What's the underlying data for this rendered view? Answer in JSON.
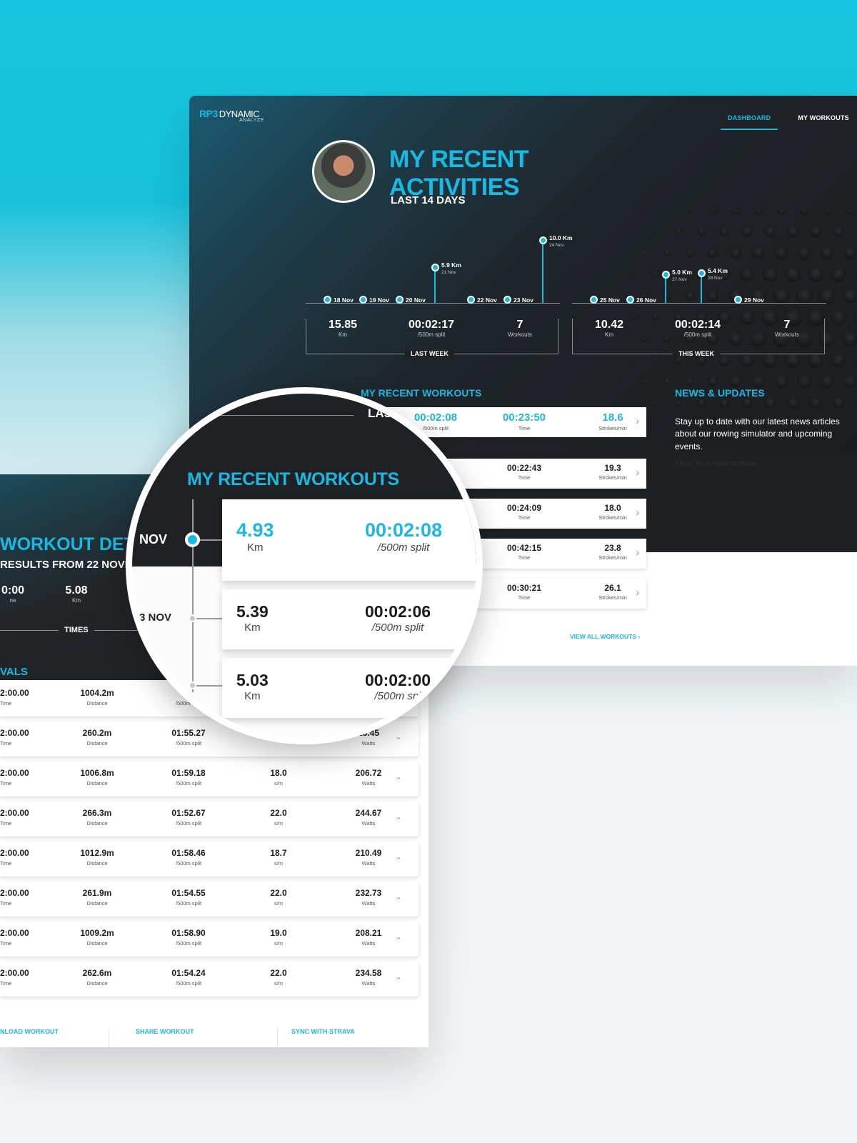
{
  "dashboard": {
    "logo": {
      "brand_prefix": "RP3",
      "brand_word": "DYNAMIC",
      "sub": "ANALYZE"
    },
    "nav": [
      "DASHBOARD",
      "MY WORKOUTS"
    ],
    "title_line1": "MY RECENT",
    "title_line2": "ACTIVITIES",
    "subtitle": "LAST 14 DAYS",
    "timeline": [
      {
        "date": "18 Nov"
      },
      {
        "date": "19 Nov"
      },
      {
        "date": "20 Nov"
      },
      {
        "value": "5.9 Km",
        "date": "21 Nov"
      },
      {
        "date": "22 Nov"
      },
      {
        "date": "23 Nov"
      },
      {
        "value": "10.0 Km",
        "date": "24 Nov"
      },
      {
        "date": "25 Nov"
      },
      {
        "date": "26 Nov"
      },
      {
        "value": "5.0 Km",
        "date": "27 Nov"
      },
      {
        "value": "5.4 Km",
        "date": "28 Nov"
      },
      {
        "date": "29 Nov"
      }
    ],
    "last_week": {
      "label": "LAST WEEK",
      "stats": [
        {
          "value": "15.85",
          "unit": "Km"
        },
        {
          "value": "00:02:17",
          "unit": "/500m split"
        },
        {
          "value": "7",
          "unit": "Workouts"
        }
      ]
    },
    "this_week": {
      "label": "THIS WEEK",
      "stats": [
        {
          "value": "10.42",
          "unit": "Km"
        },
        {
          "value": "00:02:14",
          "unit": "/500m split"
        },
        {
          "value": "7",
          "unit": "Workouts"
        }
      ]
    },
    "workouts_title": "MY RECENT WORKOUTS",
    "workouts": [
      {
        "split": "00:02:08",
        "split_unit": "/500m split",
        "time": "00:23:50",
        "time_unit": "Time",
        "spm": "18.6",
        "spm_unit": "Strokes/min"
      },
      {
        "time": "00:22:43",
        "time_unit": "Time",
        "spm": "19.3",
        "spm_unit": "Strokes/min"
      },
      {
        "time": "00:24:09",
        "time_unit": "Time",
        "spm": "18.0",
        "spm_unit": "Strokes/min"
      },
      {
        "time": "00:42:15",
        "time_unit": "Time",
        "spm": "23.8",
        "spm_unit": "Strokes/min"
      },
      {
        "time": "00:30:21",
        "time_unit": "Time",
        "spm": "26.1",
        "spm_unit": "Strokes/min"
      }
    ],
    "view_all": "VIEW ALL WORKOUTS",
    "news_title": "NEWS & UPDATES",
    "news_text": "Stay up to date with our latest news articles about our rowing simulator and upcoming events.",
    "news_empty": "There is no news to show."
  },
  "detail": {
    "title": "WORKOUT DET",
    "subtitle": "RESULTS FROM 22 NOVE",
    "stats": [
      {
        "value": "0:00",
        "unit": "ne"
      },
      {
        "value": "5.08",
        "unit": "Km"
      }
    ],
    "times_label": "TIMES",
    "intervals_label": "VALS",
    "rows": [
      {
        "time": "2:00.00",
        "distance": "1004.2m",
        "split": "01",
        "spm": "",
        "watts": ""
      },
      {
        "time": "2:00.00",
        "distance": "260.2m",
        "split": "01:55.27",
        "spm": "",
        "watts": "23.45"
      },
      {
        "time": "2:00.00",
        "distance": "1006.8m",
        "split": "01:59.18",
        "spm": "18.0",
        "watts": "206.72"
      },
      {
        "time": "2:00.00",
        "distance": "266.3m",
        "split": "01:52.67",
        "spm": "22.0",
        "watts": "244.67"
      },
      {
        "time": "2:00.00",
        "distance": "1012.9m",
        "split": "01:58.46",
        "spm": "18.7",
        "watts": "210.49"
      },
      {
        "time": "2:00.00",
        "distance": "261.9m",
        "split": "01:54.55",
        "spm": "22.0",
        "watts": "232.73"
      },
      {
        "time": "2:00.00",
        "distance": "1009.2m",
        "split": "01:58.90",
        "spm": "19.0",
        "watts": "208.21"
      },
      {
        "time": "2:00.00",
        "distance": "262.6m",
        "split": "01:54.24",
        "spm": "22.0",
        "watts": "234.58"
      }
    ],
    "units": {
      "time": "Time",
      "distance": "Distance",
      "split": "/500m split",
      "spm": "s/m",
      "watts": "Watts"
    },
    "actions": [
      "NLOAD WORKOUT",
      "SHARE WORKOUT",
      "SYNC WITH STRAVA"
    ]
  },
  "lens": {
    "last_label": "LAS",
    "title": "MY RECENT WORKOUTS",
    "dates": [
      "NOV",
      "3 NOV"
    ],
    "cards": [
      {
        "km": "4.93",
        "km_unit": "Km",
        "split": "00:02:08",
        "split_unit": "/500m split"
      },
      {
        "km": "5.39",
        "km_unit": "Km",
        "split": "00:02:06",
        "split_unit": "/500m split"
      },
      {
        "km": "5.03",
        "km_unit": "Km",
        "split": "00:02:00",
        "split_unit": "/500m spl"
      }
    ]
  }
}
